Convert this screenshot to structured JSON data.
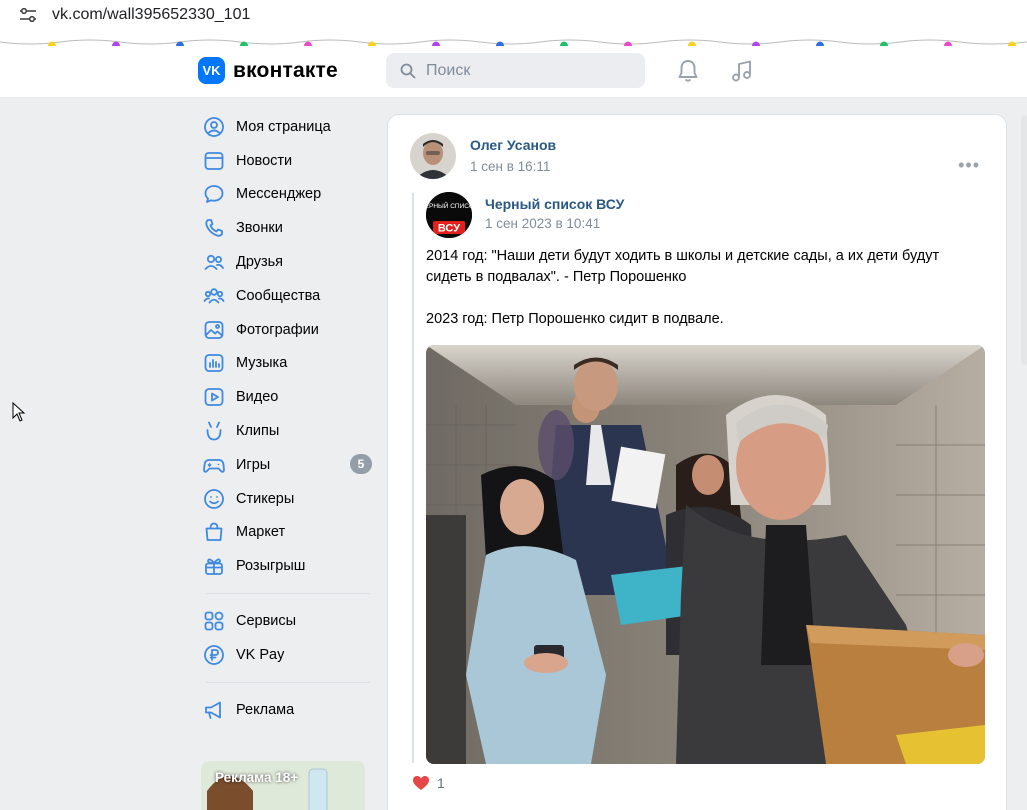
{
  "browser": {
    "url": "vk.com/wall395652330_101"
  },
  "header": {
    "logo_text": "вконтакте",
    "logo_mark": "VK",
    "search_placeholder": "Поиск",
    "icons": [
      "bell-icon",
      "music-note-icon"
    ],
    "accent_color": "#0077ff"
  },
  "sidebar": {
    "items": [
      {
        "label": "Моя страница",
        "icon": "user-circle-icon"
      },
      {
        "label": "Новости",
        "icon": "news-icon"
      },
      {
        "label": "Мессенджер",
        "icon": "chat-bubble-icon"
      },
      {
        "label": "Звонки",
        "icon": "phone-icon"
      },
      {
        "label": "Друзья",
        "icon": "friends-icon"
      },
      {
        "label": "Сообщества",
        "icon": "communities-icon"
      },
      {
        "label": "Фотографии",
        "icon": "photo-icon"
      },
      {
        "label": "Музыка",
        "icon": "music-icon"
      },
      {
        "label": "Видео",
        "icon": "video-icon"
      },
      {
        "label": "Клипы",
        "icon": "clips-icon"
      },
      {
        "label": "Игры",
        "icon": "gamepad-icon",
        "badge": "5"
      },
      {
        "label": "Стикеры",
        "icon": "smile-icon"
      },
      {
        "label": "Маркет",
        "icon": "bag-icon"
      },
      {
        "label": "Розыгрыш",
        "icon": "gift-icon"
      }
    ],
    "items2": [
      {
        "label": "Сервисы",
        "icon": "services-grid-icon"
      },
      {
        "label": "VK Pay",
        "icon": "ruble-icon"
      }
    ],
    "items3": [
      {
        "label": "Реклама",
        "icon": "megaphone-icon"
      }
    ],
    "ad_label": "Реклама 18+"
  },
  "post": {
    "author": "Олег Усанов",
    "date": "1 сен в 16:11",
    "repost": {
      "author": "Черный список ВСУ",
      "date": "1 сен 2023 в 10:41",
      "avatar_text_top": "ЧЕРНЫЙ СПИСОК",
      "avatar_text_bottom": "ВСУ",
      "text_1": "2014 год: \"Наши дети будут ходить в школы и детские сады, а их дети будут сидеть в подвалах\". - Петр Порошенко",
      "text_2": "2023 год: Петр Порошенко сидит в подвале."
    },
    "likes": "1",
    "like_color": "#e64646",
    "link_color": "#2a5885"
  }
}
